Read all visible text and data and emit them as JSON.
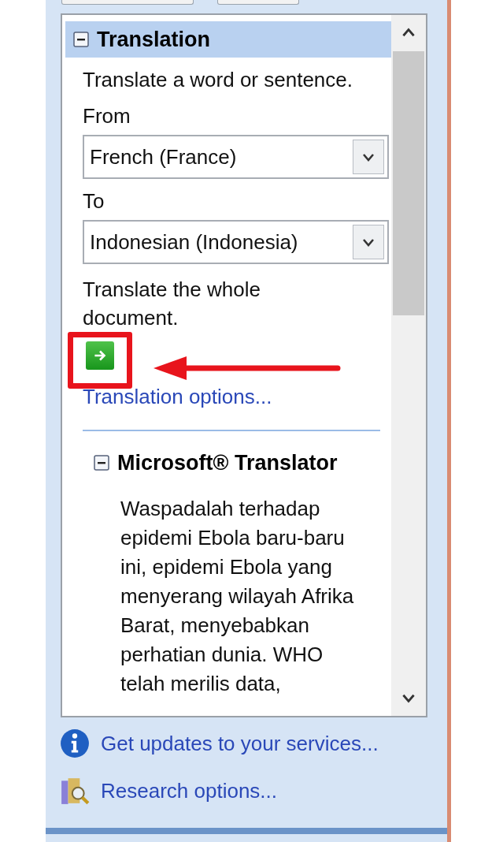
{
  "translation": {
    "title": "Translation",
    "expanded": true,
    "instruction": "Translate a word or sentence.",
    "from_label": "From",
    "from_value": "French (France)",
    "to_label": "To",
    "to_value": "Indonesian (Indonesia)",
    "document_label": "Translate the whole document.",
    "options_link": "Translation options..."
  },
  "microsoft_translator": {
    "title": "Microsoft® Translator",
    "expanded": true,
    "text": "Waspadalah terhadap epidemi Ebola baru-baru ini, epidemi Ebola yang menyerang wilayah Afrika Barat, menyebabkan perhatian dunia. WHO telah merilis data,"
  },
  "footer_links": [
    {
      "kind": "info",
      "label": "Get updates to your services..."
    },
    {
      "kind": "research",
      "label": "Research options..."
    }
  ]
}
